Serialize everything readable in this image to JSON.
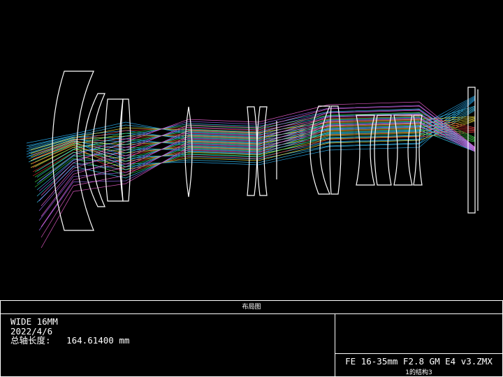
{
  "panel": {
    "title": "布局图",
    "config_name": "WIDE 16MM",
    "date": "2022/4/6",
    "total_length": "总轴长度:   164.61400 mm",
    "file_name": "FE 16-35mm F2.8 GM E4 v3.ZMX",
    "config_label": "1的结构3"
  },
  "colors": {
    "rays": [
      "#2ab7ff",
      "#3cd0ff",
      "#ffef3a",
      "#ff3c3c",
      "#43e84a",
      "#3ad8ff",
      "#a06bff",
      "#ff66e0"
    ],
    "outline": "#ffffff"
  }
}
